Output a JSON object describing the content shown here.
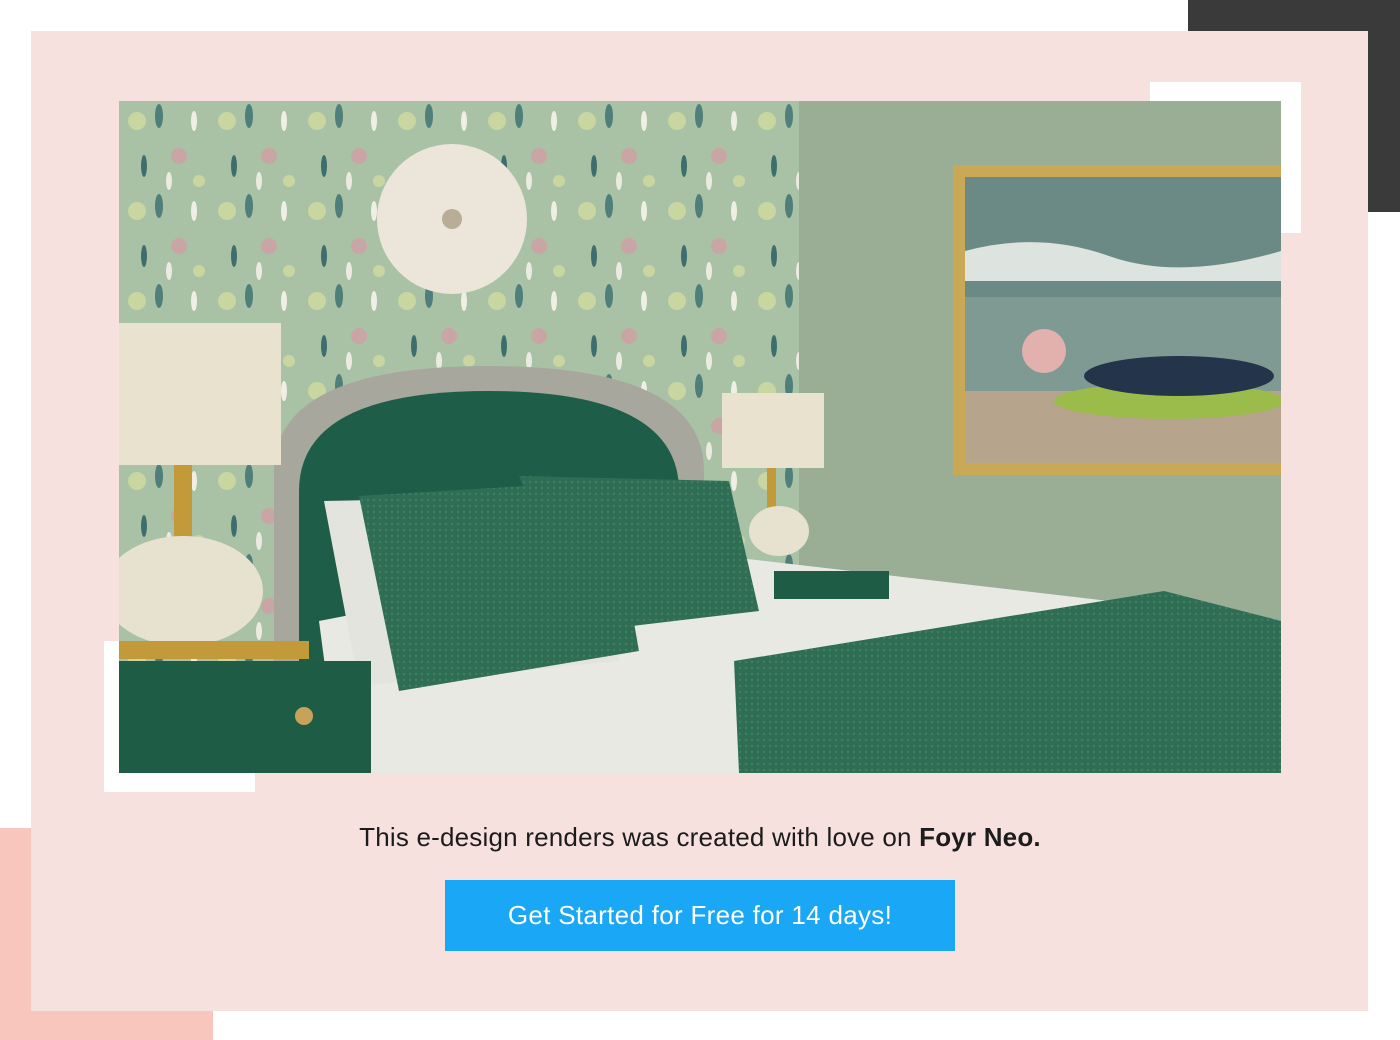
{
  "caption": {
    "text": "This e-design renders was created with love on ",
    "brand": "Foyr Neo."
  },
  "cta": {
    "label": "Get Started for Free for 14 days!"
  },
  "colors": {
    "card_bg": "#f6e1df",
    "dark_accent": "#3a3a3a",
    "salmon_accent": "#f9c6bd",
    "button_bg": "#1aa7f5",
    "button_text": "#ffffff"
  },
  "image": {
    "subject": "bedroom-render"
  }
}
